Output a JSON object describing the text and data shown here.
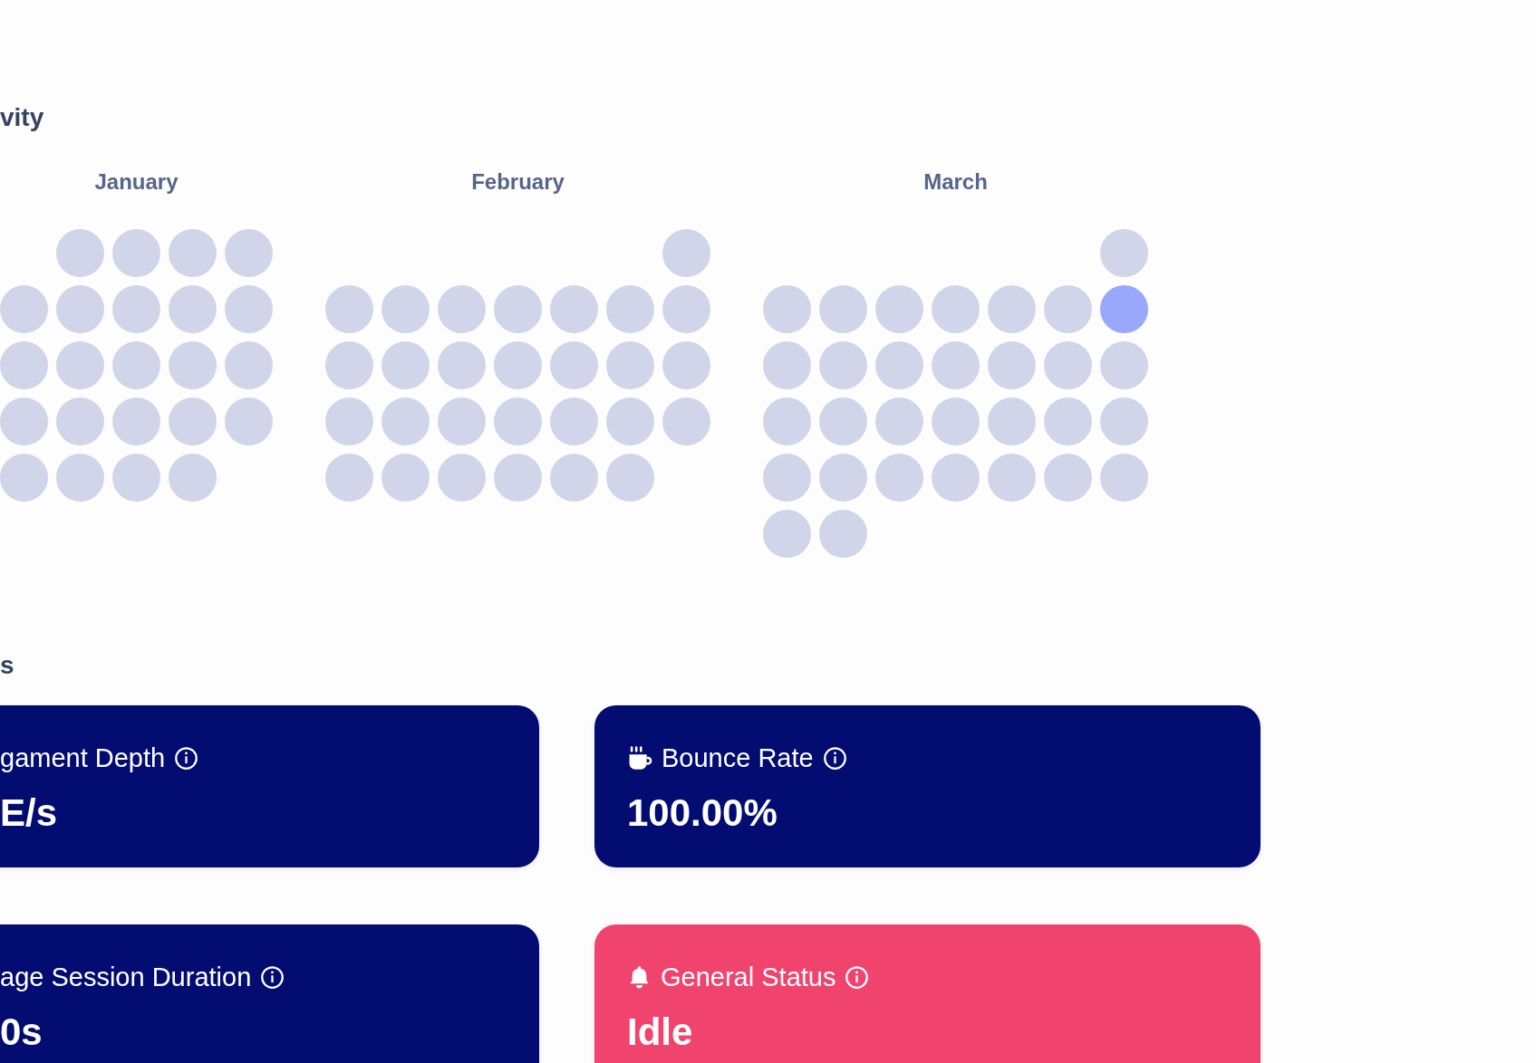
{
  "activity": {
    "title": "vity",
    "months": [
      {
        "label": "January",
        "weeks": [
          [
            {
              "kind": "empty"
            },
            {
              "kind": "day",
              "active": false
            },
            {
              "kind": "day",
              "active": false
            },
            {
              "kind": "day",
              "active": false
            },
            {
              "kind": "day",
              "active": false
            }
          ],
          [
            {
              "kind": "day",
              "active": false
            },
            {
              "kind": "day",
              "active": false
            },
            {
              "kind": "day",
              "active": false
            },
            {
              "kind": "day",
              "active": false
            },
            {
              "kind": "day",
              "active": false
            }
          ],
          [
            {
              "kind": "day",
              "active": false
            },
            {
              "kind": "day",
              "active": false
            },
            {
              "kind": "day",
              "active": false
            },
            {
              "kind": "day",
              "active": false
            },
            {
              "kind": "day",
              "active": false
            }
          ],
          [
            {
              "kind": "day",
              "active": false
            },
            {
              "kind": "day",
              "active": false
            },
            {
              "kind": "day",
              "active": false
            },
            {
              "kind": "day",
              "active": false
            },
            {
              "kind": "day",
              "active": false
            }
          ],
          [
            {
              "kind": "day",
              "active": false
            },
            {
              "kind": "day",
              "active": false
            },
            {
              "kind": "day",
              "active": false
            },
            {
              "kind": "day",
              "active": false
            },
            {
              "kind": "empty"
            }
          ]
        ]
      },
      {
        "label": "February",
        "weeks": [
          [
            {
              "kind": "empty"
            },
            {
              "kind": "empty"
            },
            {
              "kind": "empty"
            },
            {
              "kind": "empty"
            },
            {
              "kind": "empty"
            },
            {
              "kind": "empty"
            },
            {
              "kind": "day",
              "active": false
            }
          ],
          [
            {
              "kind": "day",
              "active": false
            },
            {
              "kind": "day",
              "active": false
            },
            {
              "kind": "day",
              "active": false
            },
            {
              "kind": "day",
              "active": false
            },
            {
              "kind": "day",
              "active": false
            },
            {
              "kind": "day",
              "active": false
            },
            {
              "kind": "day",
              "active": false
            }
          ],
          [
            {
              "kind": "day",
              "active": false
            },
            {
              "kind": "day",
              "active": false
            },
            {
              "kind": "day",
              "active": false
            },
            {
              "kind": "day",
              "active": false
            },
            {
              "kind": "day",
              "active": false
            },
            {
              "kind": "day",
              "active": false
            },
            {
              "kind": "day",
              "active": false
            }
          ],
          [
            {
              "kind": "day",
              "active": false
            },
            {
              "kind": "day",
              "active": false
            },
            {
              "kind": "day",
              "active": false
            },
            {
              "kind": "day",
              "active": false
            },
            {
              "kind": "day",
              "active": false
            },
            {
              "kind": "day",
              "active": false
            },
            {
              "kind": "day",
              "active": false
            }
          ],
          [
            {
              "kind": "day",
              "active": false
            },
            {
              "kind": "day",
              "active": false
            },
            {
              "kind": "day",
              "active": false
            },
            {
              "kind": "day",
              "active": false
            },
            {
              "kind": "day",
              "active": false
            },
            {
              "kind": "day",
              "active": false
            },
            {
              "kind": "empty"
            }
          ]
        ]
      },
      {
        "label": "March",
        "weeks": [
          [
            {
              "kind": "empty"
            },
            {
              "kind": "empty"
            },
            {
              "kind": "empty"
            },
            {
              "kind": "empty"
            },
            {
              "kind": "empty"
            },
            {
              "kind": "empty"
            },
            {
              "kind": "day",
              "active": false
            }
          ],
          [
            {
              "kind": "day",
              "active": false
            },
            {
              "kind": "day",
              "active": false
            },
            {
              "kind": "day",
              "active": false
            },
            {
              "kind": "day",
              "active": false
            },
            {
              "kind": "day",
              "active": false
            },
            {
              "kind": "day",
              "active": false
            },
            {
              "kind": "day",
              "active": true
            }
          ],
          [
            {
              "kind": "day",
              "active": false
            },
            {
              "kind": "day",
              "active": false
            },
            {
              "kind": "day",
              "active": false
            },
            {
              "kind": "day",
              "active": false
            },
            {
              "kind": "day",
              "active": false
            },
            {
              "kind": "day",
              "active": false
            },
            {
              "kind": "day",
              "active": false
            }
          ],
          [
            {
              "kind": "day",
              "active": false
            },
            {
              "kind": "day",
              "active": false
            },
            {
              "kind": "day",
              "active": false
            },
            {
              "kind": "day",
              "active": false
            },
            {
              "kind": "day",
              "active": false
            },
            {
              "kind": "day",
              "active": false
            },
            {
              "kind": "day",
              "active": false
            }
          ],
          [
            {
              "kind": "day",
              "active": false
            },
            {
              "kind": "day",
              "active": false
            },
            {
              "kind": "day",
              "active": false
            },
            {
              "kind": "day",
              "active": false
            },
            {
              "kind": "day",
              "active": false
            },
            {
              "kind": "day",
              "active": false
            },
            {
              "kind": "day",
              "active": false
            }
          ],
          [
            {
              "kind": "day",
              "active": false
            },
            {
              "kind": "day",
              "active": false
            },
            {
              "kind": "empty"
            },
            {
              "kind": "empty"
            },
            {
              "kind": "empty"
            },
            {
              "kind": "empty"
            },
            {
              "kind": "empty"
            }
          ]
        ]
      }
    ]
  },
  "stats": {
    "title": "s",
    "cards": [
      {
        "kind": "plain",
        "title": "gament Depth",
        "value": "E/s",
        "color": "#020c71"
      },
      {
        "kind": "cup",
        "title": "Bounce Rate",
        "value": "100.00%",
        "color": "#020c71"
      },
      {
        "kind": "plain",
        "title": "age Session Duration",
        "value": "0s",
        "color": "#020c71"
      },
      {
        "kind": "bell",
        "title": "General Status",
        "value": "Idle",
        "color": "#f0436e"
      }
    ]
  }
}
